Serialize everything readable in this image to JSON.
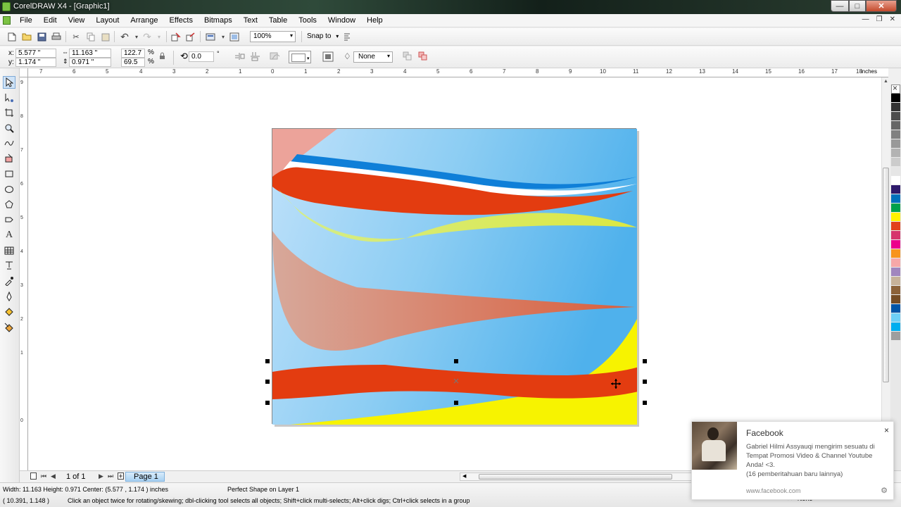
{
  "window": {
    "title": "CorelDRAW X4 - [Graphic1]",
    "minimize_glyph": "—",
    "maximize_glyph": "□",
    "close_glyph": "✕"
  },
  "menu": {
    "items": [
      "File",
      "Edit",
      "View",
      "Layout",
      "Arrange",
      "Effects",
      "Bitmaps",
      "Text",
      "Table",
      "Tools",
      "Window",
      "Help"
    ],
    "mdi_minimize": "—",
    "mdi_restore": "❐",
    "mdi_close": "✕"
  },
  "toolbar": {
    "zoom_level": "100%",
    "snap_to": "Snap to",
    "dropdown_glyph": "▾"
  },
  "propbar": {
    "x_label": "x:",
    "x_value": "5.577 \"",
    "y_label": "y:",
    "y_value": "1.174 \"",
    "width_value": "11.163 \"",
    "height_value": "0.971 \"",
    "scale_x": "122.7",
    "scale_y": "69.5",
    "percent_sign": "%",
    "rotation": "0.0",
    "degree_sign": "°",
    "outline_width": "None"
  },
  "ruler": {
    "h_labels": [
      "7",
      "6",
      "5",
      "4",
      "3",
      "2",
      "1",
      "0",
      "1",
      "2",
      "3",
      "4",
      "5",
      "6",
      "7",
      "8",
      "9",
      "10",
      "11",
      "12",
      "13",
      "14",
      "15",
      "16",
      "17",
      "18"
    ],
    "units": "inches",
    "v_labels": [
      "9",
      "8",
      "7",
      "6",
      "5",
      "4",
      "3",
      "2",
      "1",
      "0"
    ]
  },
  "palette": {
    "colors": [
      "#000000",
      "#333333",
      "#4d4d4d",
      "#666666",
      "#808080",
      "#999999",
      "#b3b3b3",
      "#cccccc",
      "#e6e6e6",
      "#ffffff",
      "#2e1a6b",
      "#0071bc",
      "#00a14b",
      "#fff200",
      "#e2401c",
      "#d6336c",
      "#ec008c",
      "#f7941d",
      "#f7a8a8",
      "#a186be",
      "#c7b299",
      "#8c6239",
      "#754c24",
      "#0054a6",
      "#6dcff6",
      "#00aeef",
      "#9e9e9e"
    ]
  },
  "pagebar": {
    "page_count": "1 of 1",
    "page_tab": "Page 1"
  },
  "status": {
    "dimensions": "Width: 11.163  Height: 0.971  Center: (5.577 , 1.174 )  inches",
    "layer_info": "Perfect Shape on Layer 1",
    "cursor_coords": "( 10.391, 1.148 )",
    "hint": "Click an object twice for rotating/skewing; dbl-clicking tool selects all objects; Shift+click multi-selects; Alt+click digs; Ctrl+click selects in a group",
    "outline_fill": "None"
  },
  "notification": {
    "source": "Facebook",
    "message": "Gabriel Hilmi Assyauqi mengirim sesuatu di Tempat Promosi Video & Channel Youtube Anda! <3.",
    "more": "(16 pemberitahuan baru lainnya)",
    "link": "www.facebook.com",
    "close_glyph": "×",
    "settings_glyph": "⚙"
  }
}
